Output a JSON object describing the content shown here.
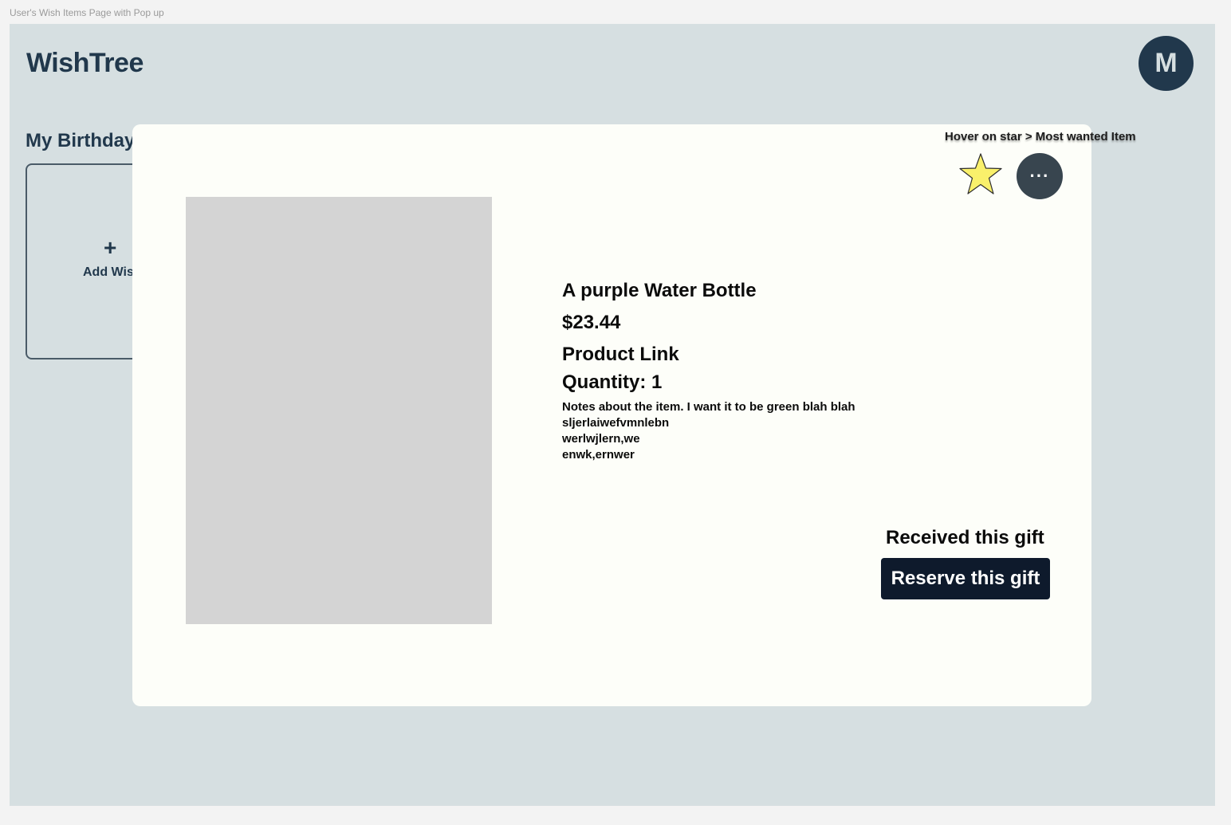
{
  "frame_label": "User's Wish Items Page with Pop up",
  "header": {
    "logo": "WishTree",
    "avatar_initial": "M"
  },
  "list": {
    "title": "My Birthday",
    "add_card": {
      "icon": "+",
      "label": "Add Wis"
    }
  },
  "modal": {
    "hover_hint": "Hover on star > Most wanted Item",
    "star_icon": "star-icon",
    "star_color": "#f9f06b",
    "more_button_label": "···",
    "item": {
      "name": "A purple Water Bottle",
      "price": "$23.44",
      "link": "Product Link",
      "quantity": "Quantity: 1",
      "notes": [
        "Notes about the item. I want it to be green blah blah",
        "sljerlaiwefvmnlebn",
        "werlwjlern,we",
        "enwk,ernwer"
      ]
    },
    "received_label": "Received this gift",
    "reserve_label": "Reserve this gift"
  },
  "colors": {
    "background": "#d6dfe1",
    "brand": "#21384c",
    "modal_bg": "#fdfef9",
    "button_dark": "#0e1a2c"
  }
}
